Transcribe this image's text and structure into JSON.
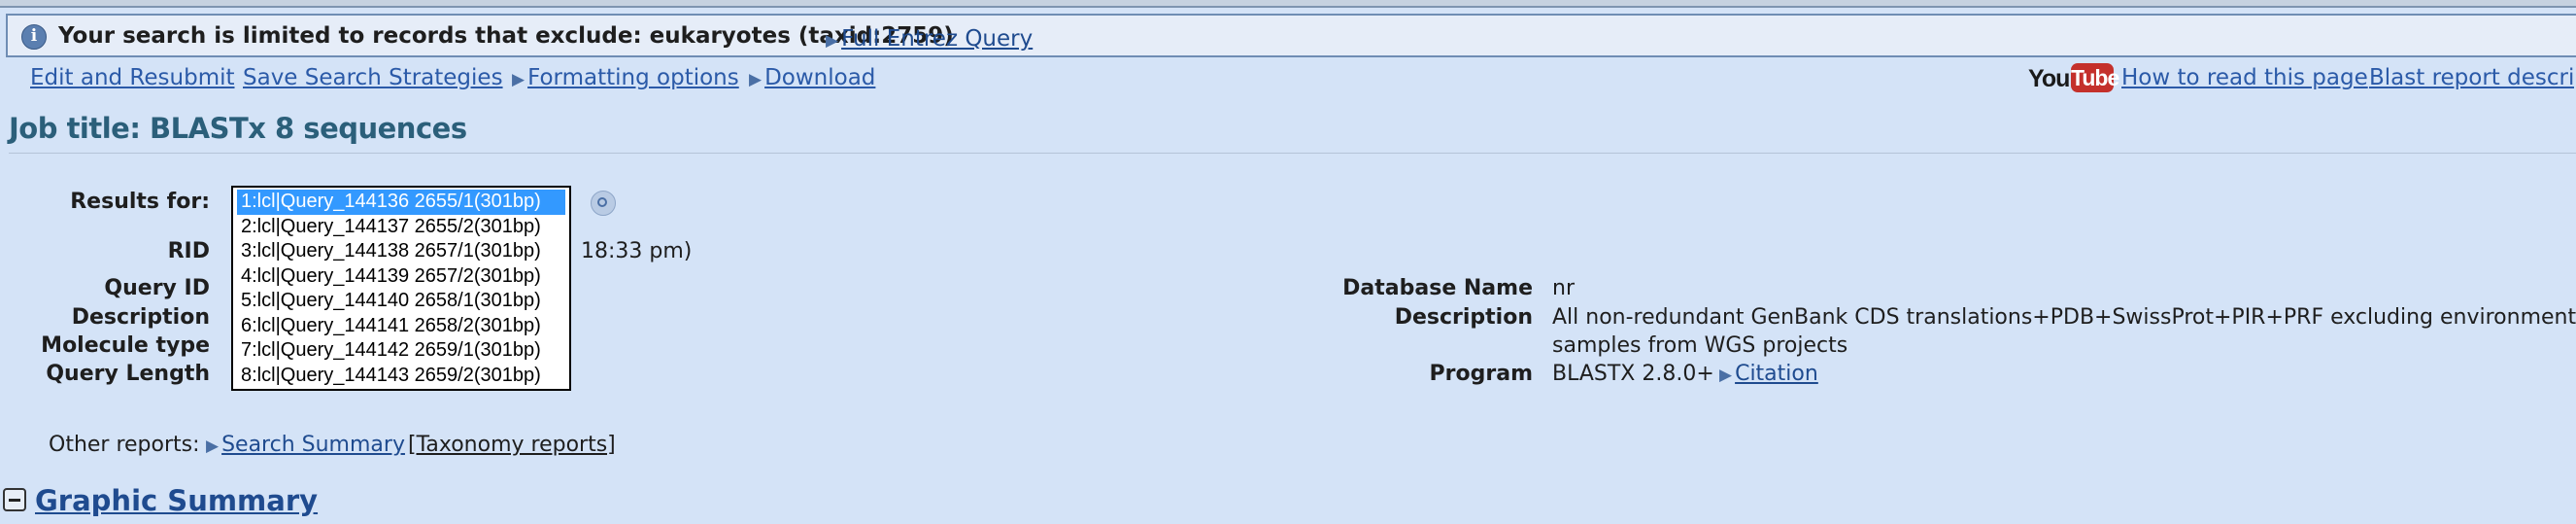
{
  "notice": {
    "text": "Your search is limited to records that exclude: eukaryotes (taxid:2759)",
    "link": "Full Entrez Query"
  },
  "toolbar": {
    "edit_resubmit": "Edit and Resubmit",
    "save_strategies": "Save Search Strategies",
    "formatting": "Formatting options ",
    "download": "Download",
    "youtube_you": "You",
    "youtube_tube": "Tube",
    "how_to_read": "How to read this page",
    "report_description": "Blast report description"
  },
  "job": {
    "title": "Job title: BLASTx 8 sequences"
  },
  "query_info": {
    "results_for_label": "Results for:",
    "rid_label": "RID",
    "rid_value_partial": "18:33 pm)",
    "query_id_label": "Query ID",
    "description_label": "Description",
    "molecule_type_label": "Molecule type",
    "query_length_label": "Query Length",
    "options": [
      "1:lcl|Query_144136 2655/1(301bp)",
      "2:lcl|Query_144137 2655/2(301bp)",
      "3:lcl|Query_144138 2657/1(301bp)",
      "4:lcl|Query_144139 2657/2(301bp)",
      "5:lcl|Query_144140 2658/1(301bp)",
      "6:lcl|Query_144141 2658/2(301bp)",
      "7:lcl|Query_144142 2659/1(301bp)",
      "8:lcl|Query_144143 2659/2(301bp)"
    ],
    "selected_index": 0
  },
  "database_info": {
    "db_name_label": "Database Name",
    "db_name_value": "nr",
    "description_label": "Description",
    "description_line1": "All non-redundant GenBank CDS translations+PDB+SwissProt+PIR+PRF excluding environmental",
    "description_line2": "samples from WGS projects",
    "program_label": "Program",
    "program_value": "BLASTX 2.8.0+",
    "citation_link": "Citation"
  },
  "other_reports": {
    "label": "Other reports:",
    "search_summary": "Search Summary",
    "taxonomy": "[Taxonomy reports]"
  },
  "graphic_summary": {
    "title": "Graphic Summary"
  },
  "icons": {
    "info": "info-icon",
    "help": "help-icon",
    "expand_triangle": "triangle-right-icon",
    "collapse": "minus-icon"
  }
}
